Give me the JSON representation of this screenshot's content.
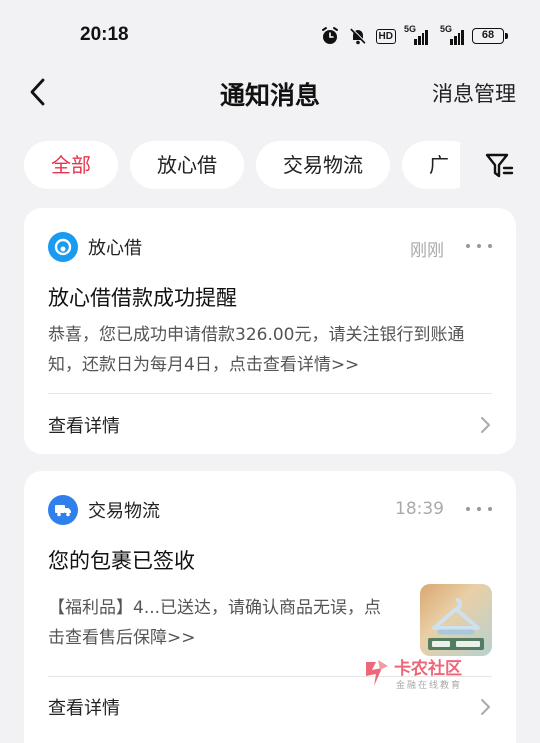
{
  "status_bar": {
    "time": "20:18",
    "hd_label": "HD",
    "signal1_label": "5G",
    "signal2_label": "5G",
    "battery": "68"
  },
  "header": {
    "title": "通知消息",
    "manage_label": "消息管理"
  },
  "tabs": [
    {
      "label": "全部",
      "active": true
    },
    {
      "label": "放心借",
      "active": false
    },
    {
      "label": "交易物流",
      "active": false
    },
    {
      "label": "广",
      "active": false
    }
  ],
  "cards": [
    {
      "app_name": "放心借",
      "time": "刚刚",
      "title": "放心借借款成功提醒",
      "body": "恭喜，您已成功申请借款326.00元，请关注银行到账通知，还款日为每月4日，点击查看详情>>",
      "link_label": "查看详情",
      "icon_color": "#1a9bf0"
    },
    {
      "app_name": "交易物流",
      "time": "18:39",
      "title": "您的包裹已签收",
      "body": "【福利品】4...已送达，请确认商品无误，点击查看售后保障>>",
      "link_label": "查看详情",
      "icon_color": "#2f80ed"
    }
  ],
  "watermark": {
    "name": "卡农社区",
    "tagline": "金融在线教育"
  },
  "colors": {
    "accent": "#e8344e",
    "background": "#f2f2f4"
  }
}
